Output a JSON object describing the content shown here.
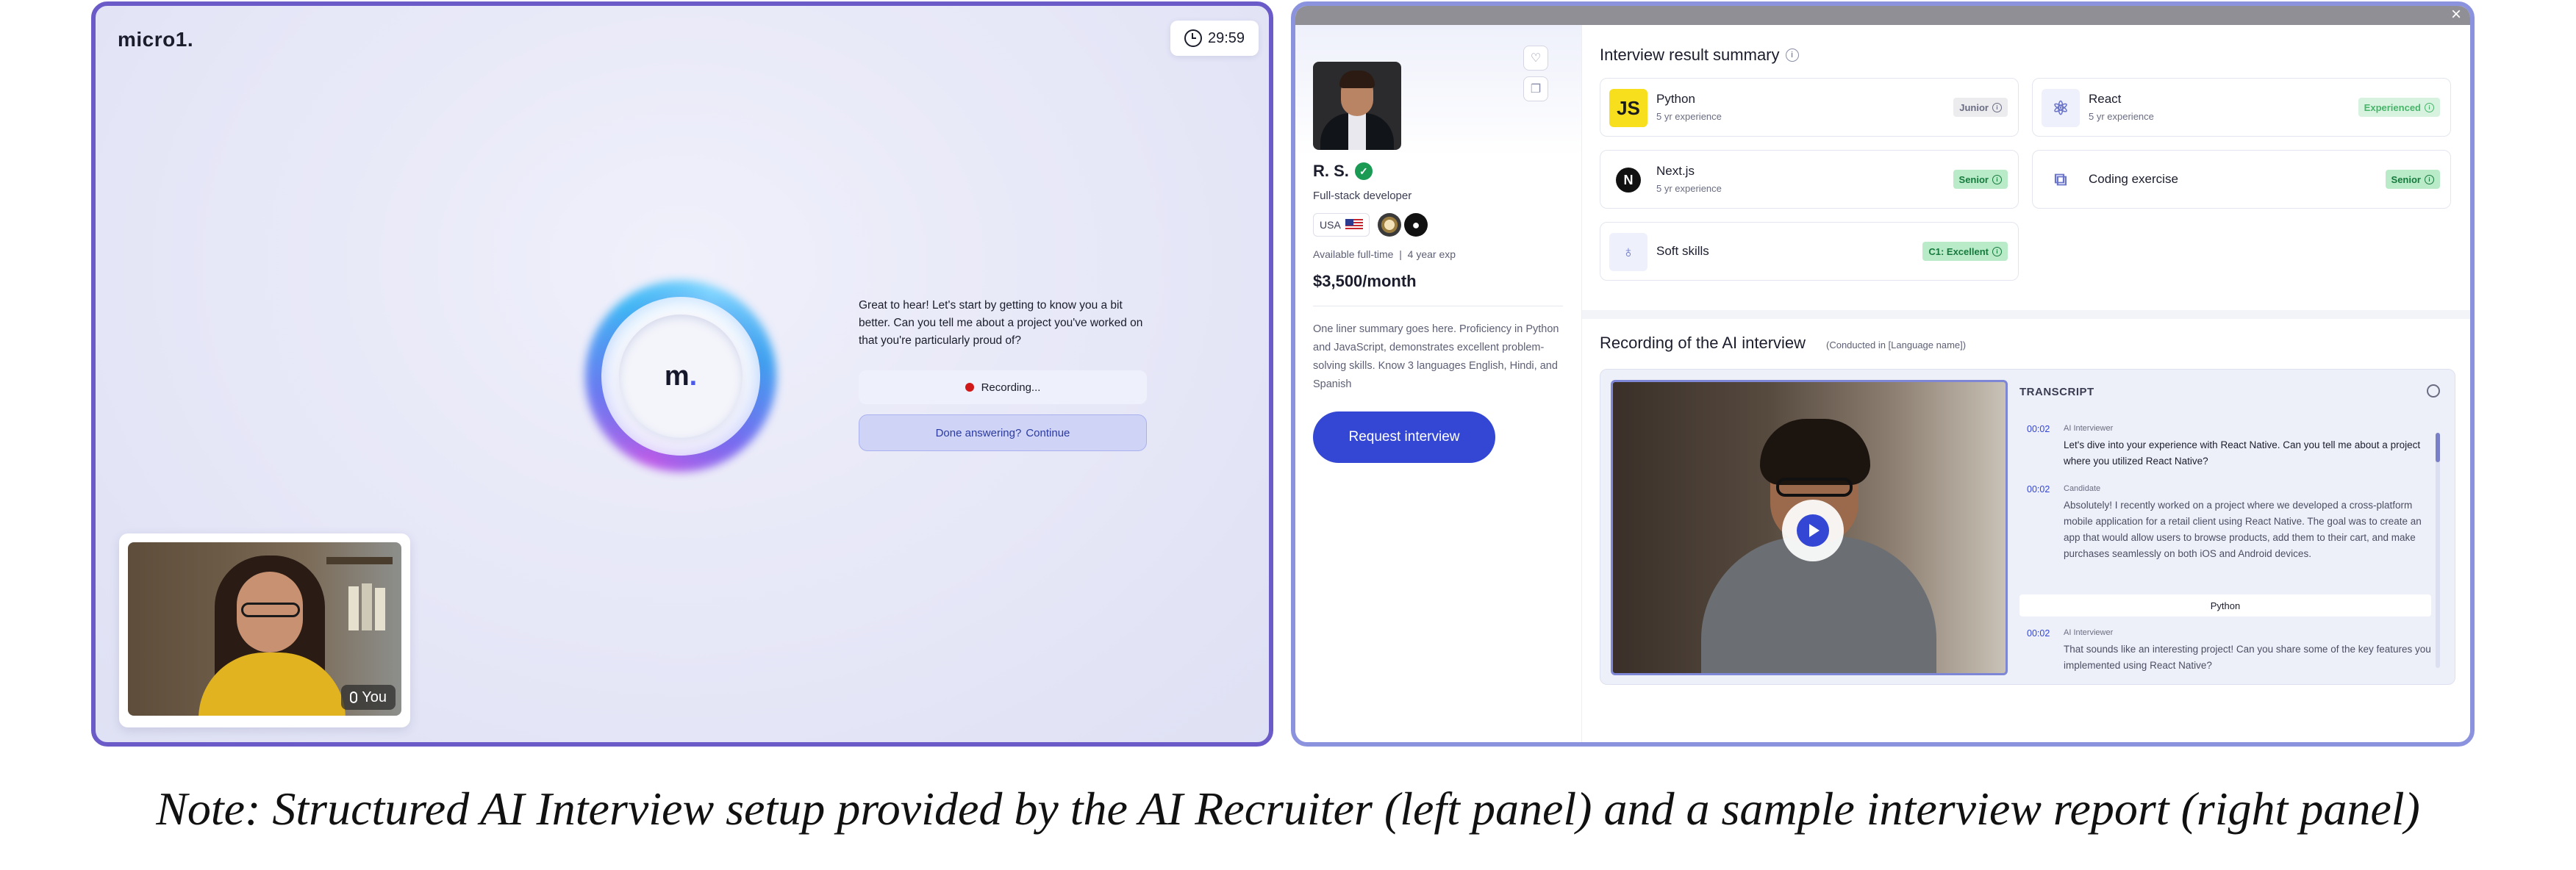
{
  "left": {
    "logo": "micro1.",
    "timer": "29:59",
    "orb_letter": "m",
    "orb_dot": ".",
    "ai_message": "Great to hear! Let's start by getting to know you a bit better. Can you tell me about a project you've worked on that you're particularly proud of?",
    "recording_label": "Recording...",
    "continue_prefix": "Done answering?",
    "continue_link": "Continue",
    "you_label": "You"
  },
  "right": {
    "close_glyph": "×",
    "profile": {
      "name": "R. S.",
      "role": "Full-stack developer",
      "country": "USA",
      "availability": "Available full-time",
      "experience": "4 year exp",
      "rate": "$3,500/month",
      "summary": "One liner summary goes here. Proficiency in Python and JavaScript, demonstrates excellent problem-solving skills. Know 3 languages English, Hindi, and Spanish",
      "request_button": "Request interview"
    },
    "results_title": "Interview result summary",
    "skills": [
      {
        "name": "Python",
        "exp": "5 yr experience",
        "level": "Junior",
        "icon": "JS"
      },
      {
        "name": "React",
        "exp": "5 yr experience",
        "level": "Experienced",
        "icon": "react-icon"
      },
      {
        "name": "Next.js",
        "exp": "5 yr experience",
        "level": "Senior",
        "icon": "N"
      },
      {
        "name": "Coding exercise",
        "level": "Senior",
        "icon": "code-exercise-icon"
      },
      {
        "name": "Soft skills",
        "level": "C1: Excellent",
        "icon": "lightbulb-icon"
      }
    ],
    "recording_title": "Recording of the AI interview",
    "recording_sub": "(Conducted in [Language name])",
    "transcript": {
      "label": "TRANSCRIPT",
      "entries": [
        {
          "time": "00:02",
          "role": "AI Interviewer",
          "text": "Let's dive into your experience with React Native. Can you tell me about a project where you utilized React Native?"
        },
        {
          "time": "00:02",
          "role": "Candidate",
          "text": "Absolutely! I recently worked on a project where we developed a cross-platform mobile application for a retail client using React Native. The goal was to create an app that would allow users to browse products, add them to their cart, and make purchases seamlessly on both iOS and Android devices."
        },
        {
          "time": "00:02",
          "role": "AI Interviewer",
          "text": "That sounds like an interesting project! Can you share some of the key features you implemented using React Native?"
        }
      ],
      "topic_tag": "Python"
    },
    "colors": {
      "accent": "#3346d4",
      "senior": "#b9ebc9",
      "junior": "#ececef"
    }
  },
  "caption": "Note: Structured AI Interview setup provided by the AI Recruiter (left panel) and a sample interview report (right panel)"
}
